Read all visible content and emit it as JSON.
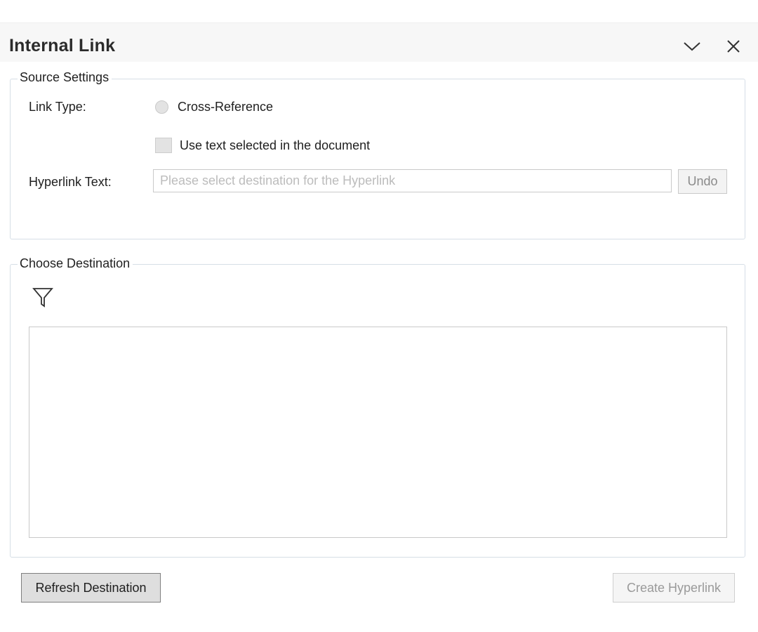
{
  "panel": {
    "title": "Internal Link",
    "collapse_icon": "chevron-down-icon",
    "close_icon": "close-icon"
  },
  "source_settings": {
    "legend": "Source Settings",
    "link_type_label": "Link Type:",
    "link_type_option": "Cross-Reference",
    "use_selected_text_label": "Use text selected in the document",
    "hyperlink_text_label": "Hyperlink Text:",
    "hyperlink_text_value": "",
    "hyperlink_text_placeholder": "Please select destination for the Hyperlink",
    "undo_label": "Undo"
  },
  "choose_destination": {
    "legend": "Choose Destination",
    "filter_icon": "filter-icon",
    "items": []
  },
  "footer": {
    "refresh_label": "Refresh Destination",
    "create_label": "Create Hyperlink"
  },
  "colors": {
    "border": "#d6dee6",
    "disabled_text": "#9a9a9a",
    "placeholder": "#bcbcbc"
  }
}
